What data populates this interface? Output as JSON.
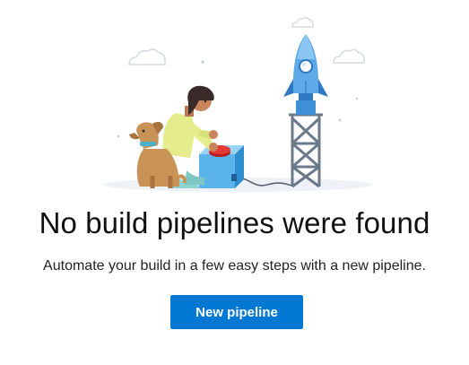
{
  "empty_state": {
    "title": "No build pipelines were found",
    "description": "Automate your build in a few easy steps with a new pipeline.",
    "button_label": "New pipeline"
  },
  "colors": {
    "accent": "#0078d4",
    "rocket": "#5ea9e8",
    "dog": "#c99358",
    "shirt": "#e4ec8c"
  },
  "illustration": {
    "items": [
      "cloud-icon",
      "rocket-icon",
      "launch-tower-icon",
      "person-icon",
      "dog-icon",
      "launch-box-icon",
      "launch-button-icon",
      "cable-icon",
      "sparkle-icon"
    ]
  }
}
